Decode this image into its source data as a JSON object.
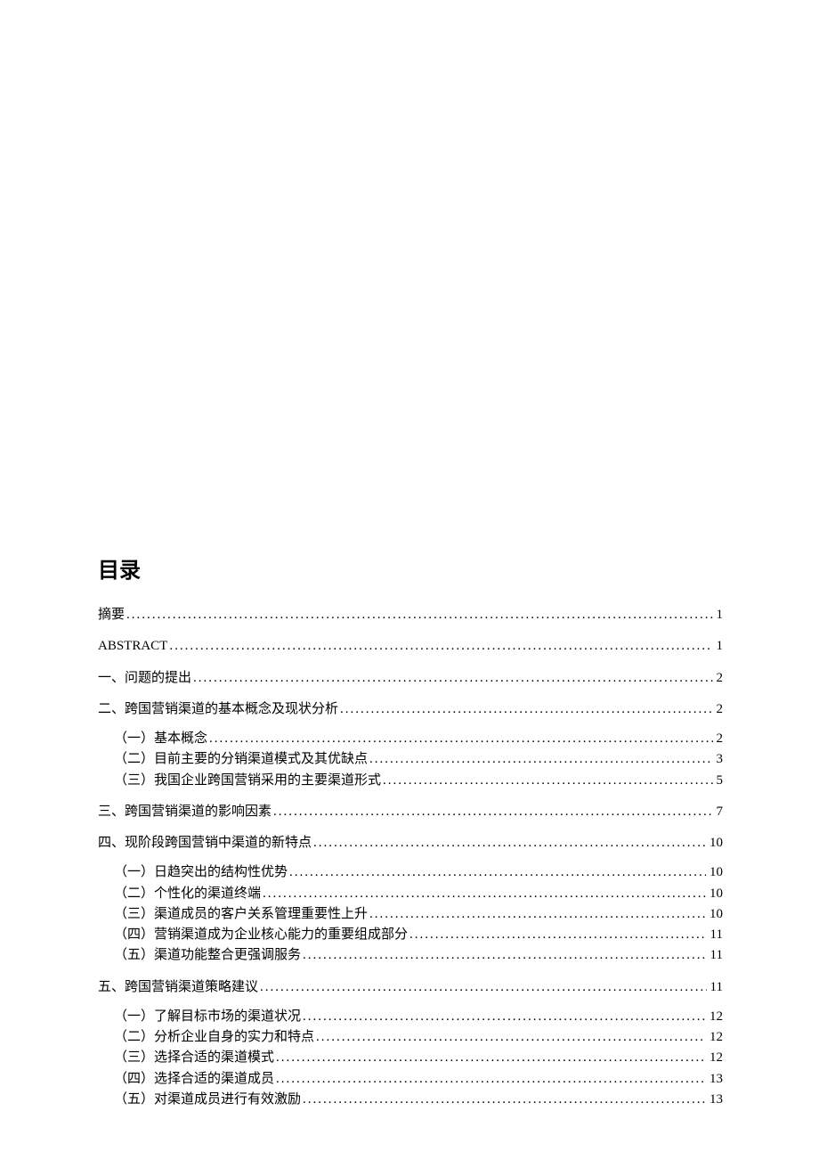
{
  "title": "目录",
  "entries": [
    {
      "level": 1,
      "label": "摘要",
      "page": "1"
    },
    {
      "level": 1,
      "label": "ABSTRACT",
      "page": "1"
    },
    {
      "level": 1,
      "label": "一、问题的提出",
      "page": "2"
    },
    {
      "level": 1,
      "label": "二、跨国营销渠道的基本概念及现状分析",
      "page": "2"
    },
    {
      "level": 2,
      "label": "（一）基本概念",
      "page": "2"
    },
    {
      "level": 2,
      "label": "（二）目前主要的分销渠道模式及其优缺点",
      "page": "3"
    },
    {
      "level": 2,
      "label": "（三）我国企业跨国营销采用的主要渠道形式",
      "page": "5"
    },
    {
      "level": 1,
      "label": "三、跨国营销渠道的影响因素",
      "page": "7"
    },
    {
      "level": 1,
      "label": "四、现阶段跨国营销中渠道的新特点",
      "page": "10"
    },
    {
      "level": 2,
      "label": "（一）日趋突出的结构性优势",
      "page": "10"
    },
    {
      "level": 2,
      "label": "（二）个性化的渠道终端",
      "page": "10"
    },
    {
      "level": 2,
      "label": "（三）渠道成员的客户关系管理重要性上升",
      "page": "10"
    },
    {
      "level": 2,
      "label": "（四）营销渠道成为企业核心能力的重要组成部分",
      "page": "11"
    },
    {
      "level": 2,
      "label": "（五）渠道功能整合更强调服务",
      "page": "11"
    },
    {
      "level": 1,
      "label": "五、跨国营销渠道策略建议",
      "page": "11"
    },
    {
      "level": 2,
      "label": "（一）了解目标市场的渠道状况",
      "page": "12"
    },
    {
      "level": 2,
      "label": "（二）分析企业自身的实力和特点",
      "page": "12"
    },
    {
      "level": 2,
      "label": "（三）选择合适的渠道模式",
      "page": "12"
    },
    {
      "level": 2,
      "label": "（四）选择合适的渠道成员",
      "page": "13"
    },
    {
      "level": 2,
      "label": "（五）对渠道成员进行有效激励",
      "page": "13"
    }
  ]
}
